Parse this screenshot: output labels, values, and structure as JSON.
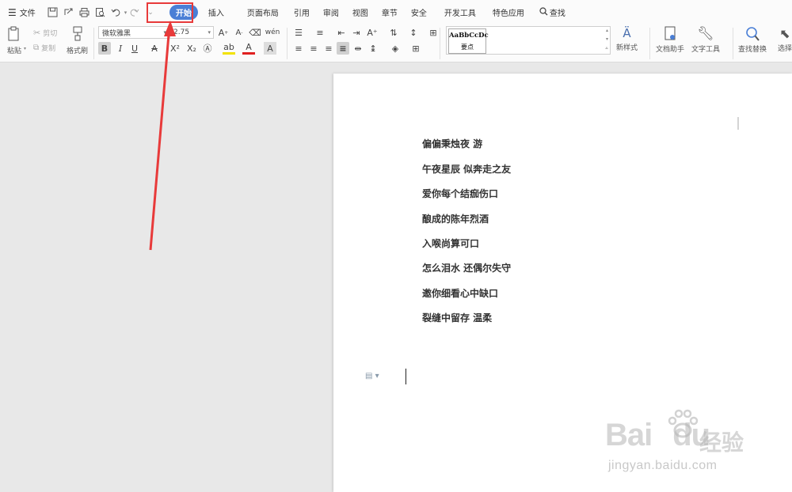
{
  "menubar": {
    "file_label": "文件",
    "tabs": [
      {
        "label": "开始",
        "active": true
      },
      {
        "label": "插入"
      },
      {
        "label": "页面布局"
      },
      {
        "label": "引用"
      },
      {
        "label": "审阅"
      },
      {
        "label": "视图"
      },
      {
        "label": "章节"
      },
      {
        "label": "安全"
      },
      {
        "label": "开发工具"
      },
      {
        "label": "特色应用"
      }
    ],
    "search_label": "查找"
  },
  "ribbon": {
    "paste": "粘贴",
    "cut": "剪切",
    "copy": "复制",
    "format_painter": "格式刷",
    "font_name": "微软雅黑",
    "font_size": "2.75",
    "style_sample_text": "AaBbCcDc",
    "style_sample_name": "要点",
    "new_style": "新样式",
    "doc_assistant": "文档助手",
    "text_tools": "文字工具",
    "find_replace": "查找替换",
    "select": "选择"
  },
  "document": {
    "lines": [
      "偏偏秉烛夜 游",
      "午夜星辰 似奔走之友",
      "爱你每个结痂伤口",
      "酿成的陈年烈酒",
      "入喉尚算可口",
      "怎么泪水 还偶尔失守",
      "邀你细看心中缺口",
      "裂缝中留存 温柔"
    ]
  },
  "watermark": {
    "brand": "Bai",
    "brand2": "du",
    "cn": "经验",
    "url": "jingyan.baidu.com"
  },
  "colors": {
    "accent": "#4a7fd6",
    "annotation": "#e83a3a"
  }
}
